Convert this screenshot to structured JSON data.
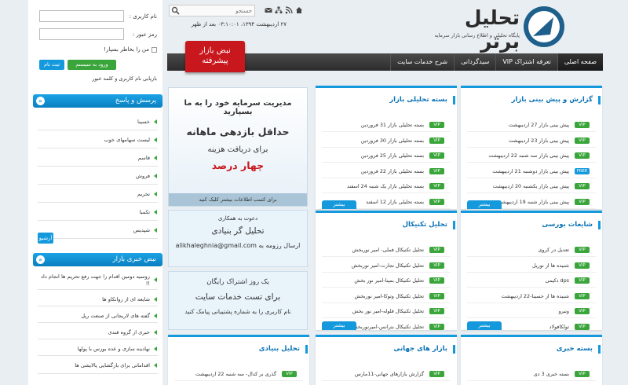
{
  "colors": {
    "accent": "#1499dc",
    "green": "#3aa53a",
    "red": "#c8181e",
    "orange": "#e8901a"
  },
  "header": {
    "brand": "تحلیل برتر",
    "tagline": "پایگاه تحلیلی و اطلاع رسانی بازار سرمایه",
    "search_placeholder": "جستجو",
    "datetime": "۲۷ اردیبهشت ۱۳۹۴، ۰۳:۱۰:۰۱ بعد از ظهر",
    "icons": [
      "home-icon",
      "rss-icon",
      "sitemap-icon",
      "mail-icon"
    ]
  },
  "ribbon": {
    "line1": "نبض بازار",
    "line2": "پیشرفته"
  },
  "nav": [
    "صفحه اصلی",
    "تعرفه اشتراک VIP",
    "سیدگردانی",
    "شرح خدمات سایت"
  ],
  "login": {
    "username_label": "نام کاربری :",
    "password_label": "رمز عبور :",
    "remember_label": "من را بخاطر بسپار!",
    "login_button": "ورود به سیستم",
    "register_button": "ثبت نام",
    "recover_link": "بازیابی نام کاربری و کلمه عبور"
  },
  "widgets": {
    "qa": {
      "title": "پرسش و پاسخ",
      "items": [
        "خسینا",
        "لیست سهامهای خوب",
        "قاسم",
        "فروش",
        "تحریم",
        "تکمبا",
        "شپدیس"
      ],
      "archive": "آرشیو"
    },
    "pulse": {
      "title": "نبض خبری بازار",
      "items": [
        "روسیه دومین اقدام را جهت رفع تحریم ها انجام داد !!",
        "شایعه ای از روانکاو ها",
        "گفته های لاریجانی از صنعت ریل",
        "خبری از گروه قندی",
        "نهادینه سازی و عده بورس با پولها",
        "اقداماتی برای بازگشایی پالایشی ها"
      ]
    }
  },
  "banners": {
    "b1": {
      "l1": "مدیریت سرمایه خود را به ما بسپارید",
      "l2": "حداقل بازدهی ماهانه",
      "l3": "برای دریافت هزینه",
      "l4": "چهار درصد",
      "foot": "برای کسب اطلاعات بیشتر کلیک کنید"
    },
    "b2": {
      "l1": "دعوت به همکاری",
      "l2": "تحلیل گر بنیادی",
      "l3": "ارسال رزومه به",
      "email": "alikhaleghnia@gmail.com"
    },
    "b3": {
      "l1": "یک روز اشتراک رایگان",
      "l2": "برای تست خدمات سایت",
      "l3": "نام کاربری را به شماره پشتیبانی پیامک کنید"
    }
  },
  "panels": {
    "p1": {
      "title": "گزارش و پیش بینی بازار",
      "rows": [
        {
          "b": "VIP",
          "t": "پیش بینی بازار 27 اردیبهشت"
        },
        {
          "b": "VIP",
          "t": "پیش بینی بازار 23 اردیبهشت"
        },
        {
          "b": "VIP",
          "t": "پیش بینی بازار سه شنبه 22 اردیبهشت"
        },
        {
          "b": "FREE",
          "t": "پیش بینی بازار دوشنبه 21 اردیبهشت"
        },
        {
          "b": "VIP",
          "t": "پیش بینی بازار یکشنبه 20 اردیبهشت"
        },
        {
          "b": "VIP",
          "t": "پیش بینی بازار شنبه 19 اردیبهشت"
        }
      ],
      "more": "بیشتر"
    },
    "p2": {
      "title": "بسته تحلیلی بازار",
      "rows": [
        {
          "b": "VIP",
          "t": "بسته تحلیلی بازار 31 فروردین"
        },
        {
          "b": "VIP",
          "t": "بسته تحلیلی بازار 30 فروردین"
        },
        {
          "b": "VIP",
          "t": "بسته تحلیلی بازار 25 فروردین"
        },
        {
          "b": "VIP",
          "t": "بسته تحلیلی بازار 22 فروردین"
        },
        {
          "b": "VIP",
          "t": "بسته تحلیلی بازار یک شنبه 24 اسفند"
        },
        {
          "b": "VIP",
          "t": "بسته تحلیلی بازار 12 اسفند"
        }
      ],
      "more": "بیشتر"
    },
    "p3": {
      "title": "شایعات بورسی",
      "rows": [
        {
          "b": "VIP",
          "t": "تعدیل در کروی"
        },
        {
          "b": "VIP",
          "t": "شنیده ها از نوریل"
        },
        {
          "b": "VIP",
          "t": "dps دکیمی"
        },
        {
          "b": "VIP",
          "t": "شنیده ها از حسینا-22 اردیبهشت"
        },
        {
          "b": "VIP",
          "t": "ونیرو"
        },
        {
          "b": "VIP",
          "t": "تولکافولاد"
        }
      ],
      "more": "بیشتر"
    },
    "p4": {
      "title": "تحلیل تکنیکال",
      "rows": [
        {
          "b": "VIP",
          "t": "تحلیل تکنیکال فملی- امیر نوربخش"
        },
        {
          "b": "VIP",
          "t": "تحلیل تکنیکال تجارت-امیر نوربخش"
        },
        {
          "b": "VIP",
          "t": "تحلیل تکنیکال بمپنا-امیر نور بخش"
        },
        {
          "b": "VIP",
          "t": "تحلیل تکنیکال وتوکا-امیر نوربخش"
        },
        {
          "b": "VIP",
          "t": "تحلیل تکنیکال فلوله-امیر نور بخش"
        },
        {
          "b": "VIP",
          "t": "تحلیل تکنیکال بترانس-امیرنوربخش"
        }
      ],
      "more": "بیشتر"
    },
    "p5": {
      "title": "بسته خبری",
      "rows": [
        {
          "b": "VIP",
          "t": "بسته خبری 3 دی"
        }
      ]
    },
    "p6": {
      "title": "بازار های جهانی",
      "rows": [
        {
          "b": "VIP",
          "t": "گزارش بازارهای جهانی-11مارس"
        }
      ]
    },
    "p7": {
      "title": "تحلیل بنیادی",
      "rows": [
        {
          "b": "VIP",
          "t": "گذری بر کدال- سه شنبه 22 اردیبهشت"
        }
      ]
    }
  }
}
